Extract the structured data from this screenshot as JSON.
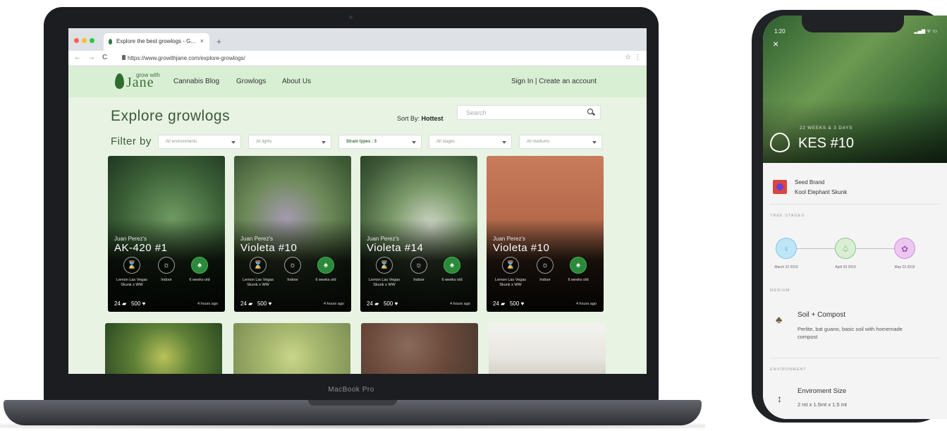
{
  "laptop": {
    "brand_label": "MacBook Pro",
    "browser": {
      "tab_title": "Explore the best growlogs - G...",
      "tab_close": "×",
      "new_tab": "+",
      "back": "←",
      "forward": "→",
      "reload": "C",
      "url": "https://www.growithjane.com/explore-growlogs/",
      "star": "☆",
      "menu": "⋮"
    },
    "site": {
      "logo_small": "grow with",
      "logo_big": "Jane",
      "nav": [
        "Cannabis Blog",
        "Growlogs",
        "About Us"
      ],
      "account_links": "Sign In | Create an account",
      "page_title": "Explore growlogs",
      "sort_prefix": "Sort By:",
      "sort_value": "Hottest",
      "search_placeholder": "Search",
      "filter_label": "Filter by",
      "filters": [
        "All environments",
        "All lights",
        "Strain types : 3",
        "All stages",
        "All mediums"
      ],
      "cards": [
        {
          "owner": "Juan Perez's",
          "title": "AK-420 #1",
          "strain": "Lemon Las Vegas Skunk x WW",
          "environment": "Indoor",
          "age": "6 weeks old",
          "comments": "24",
          "likes": "500",
          "time": "4 hours ago"
        },
        {
          "owner": "Juan Perez's",
          "title": "Violeta #10",
          "strain": "Lemon Las Vegas Skunk x WW",
          "environment": "Indoor",
          "age": "6 weeks old",
          "comments": "24",
          "likes": "500",
          "time": "4 hours ago"
        },
        {
          "owner": "Juan Perez's",
          "title": "Violeta #14",
          "strain": "Lemon Las Vegas Skunk x WW",
          "environment": "Indoor",
          "age": "6 weeks old",
          "comments": "24",
          "likes": "500",
          "time": "4 hours ago"
        },
        {
          "owner": "Juan Perez's",
          "title": "Violeta #10",
          "strain": "Lemon Las Vegas Skunk x WW",
          "environment": "Indoor",
          "age": "6 weeks old",
          "comments": "24",
          "likes": "500",
          "time": "4 hours ago"
        }
      ]
    }
  },
  "phone": {
    "status_time": "1:20",
    "status_icons": "▂▄▆ ᯤ ▭",
    "close": "×",
    "plant_age": "22 WEEKS & 3 DAYS",
    "plant_name": "KES #10",
    "seed_brand_label": "Seed Brand",
    "seed_brand_value": "Kool Elephant Skunk",
    "stages_section": "TREE STAGES",
    "stages": [
      {
        "date": "March 22 2019",
        "color": "#bfe6f7"
      },
      {
        "date": "April 03 2019",
        "color": "#d8efd3"
      },
      {
        "date": "May 23 2019",
        "color": "#ecc7f0"
      }
    ],
    "medium_section": "MEDIUM",
    "medium_title": "Soil + Compost",
    "medium_description": "Perlite, bat guano, basic soil with homemade compost",
    "environment_section": "ENVIRONMENT",
    "env_size_label": "Enviroment Size",
    "env_size_value": "2 mt x 1.5mt x 1.5 mt"
  },
  "colors": {
    "brand_green": "#3c6f3a",
    "page_bg": "#e8f3e4",
    "header_bg": "#d9efd4"
  }
}
